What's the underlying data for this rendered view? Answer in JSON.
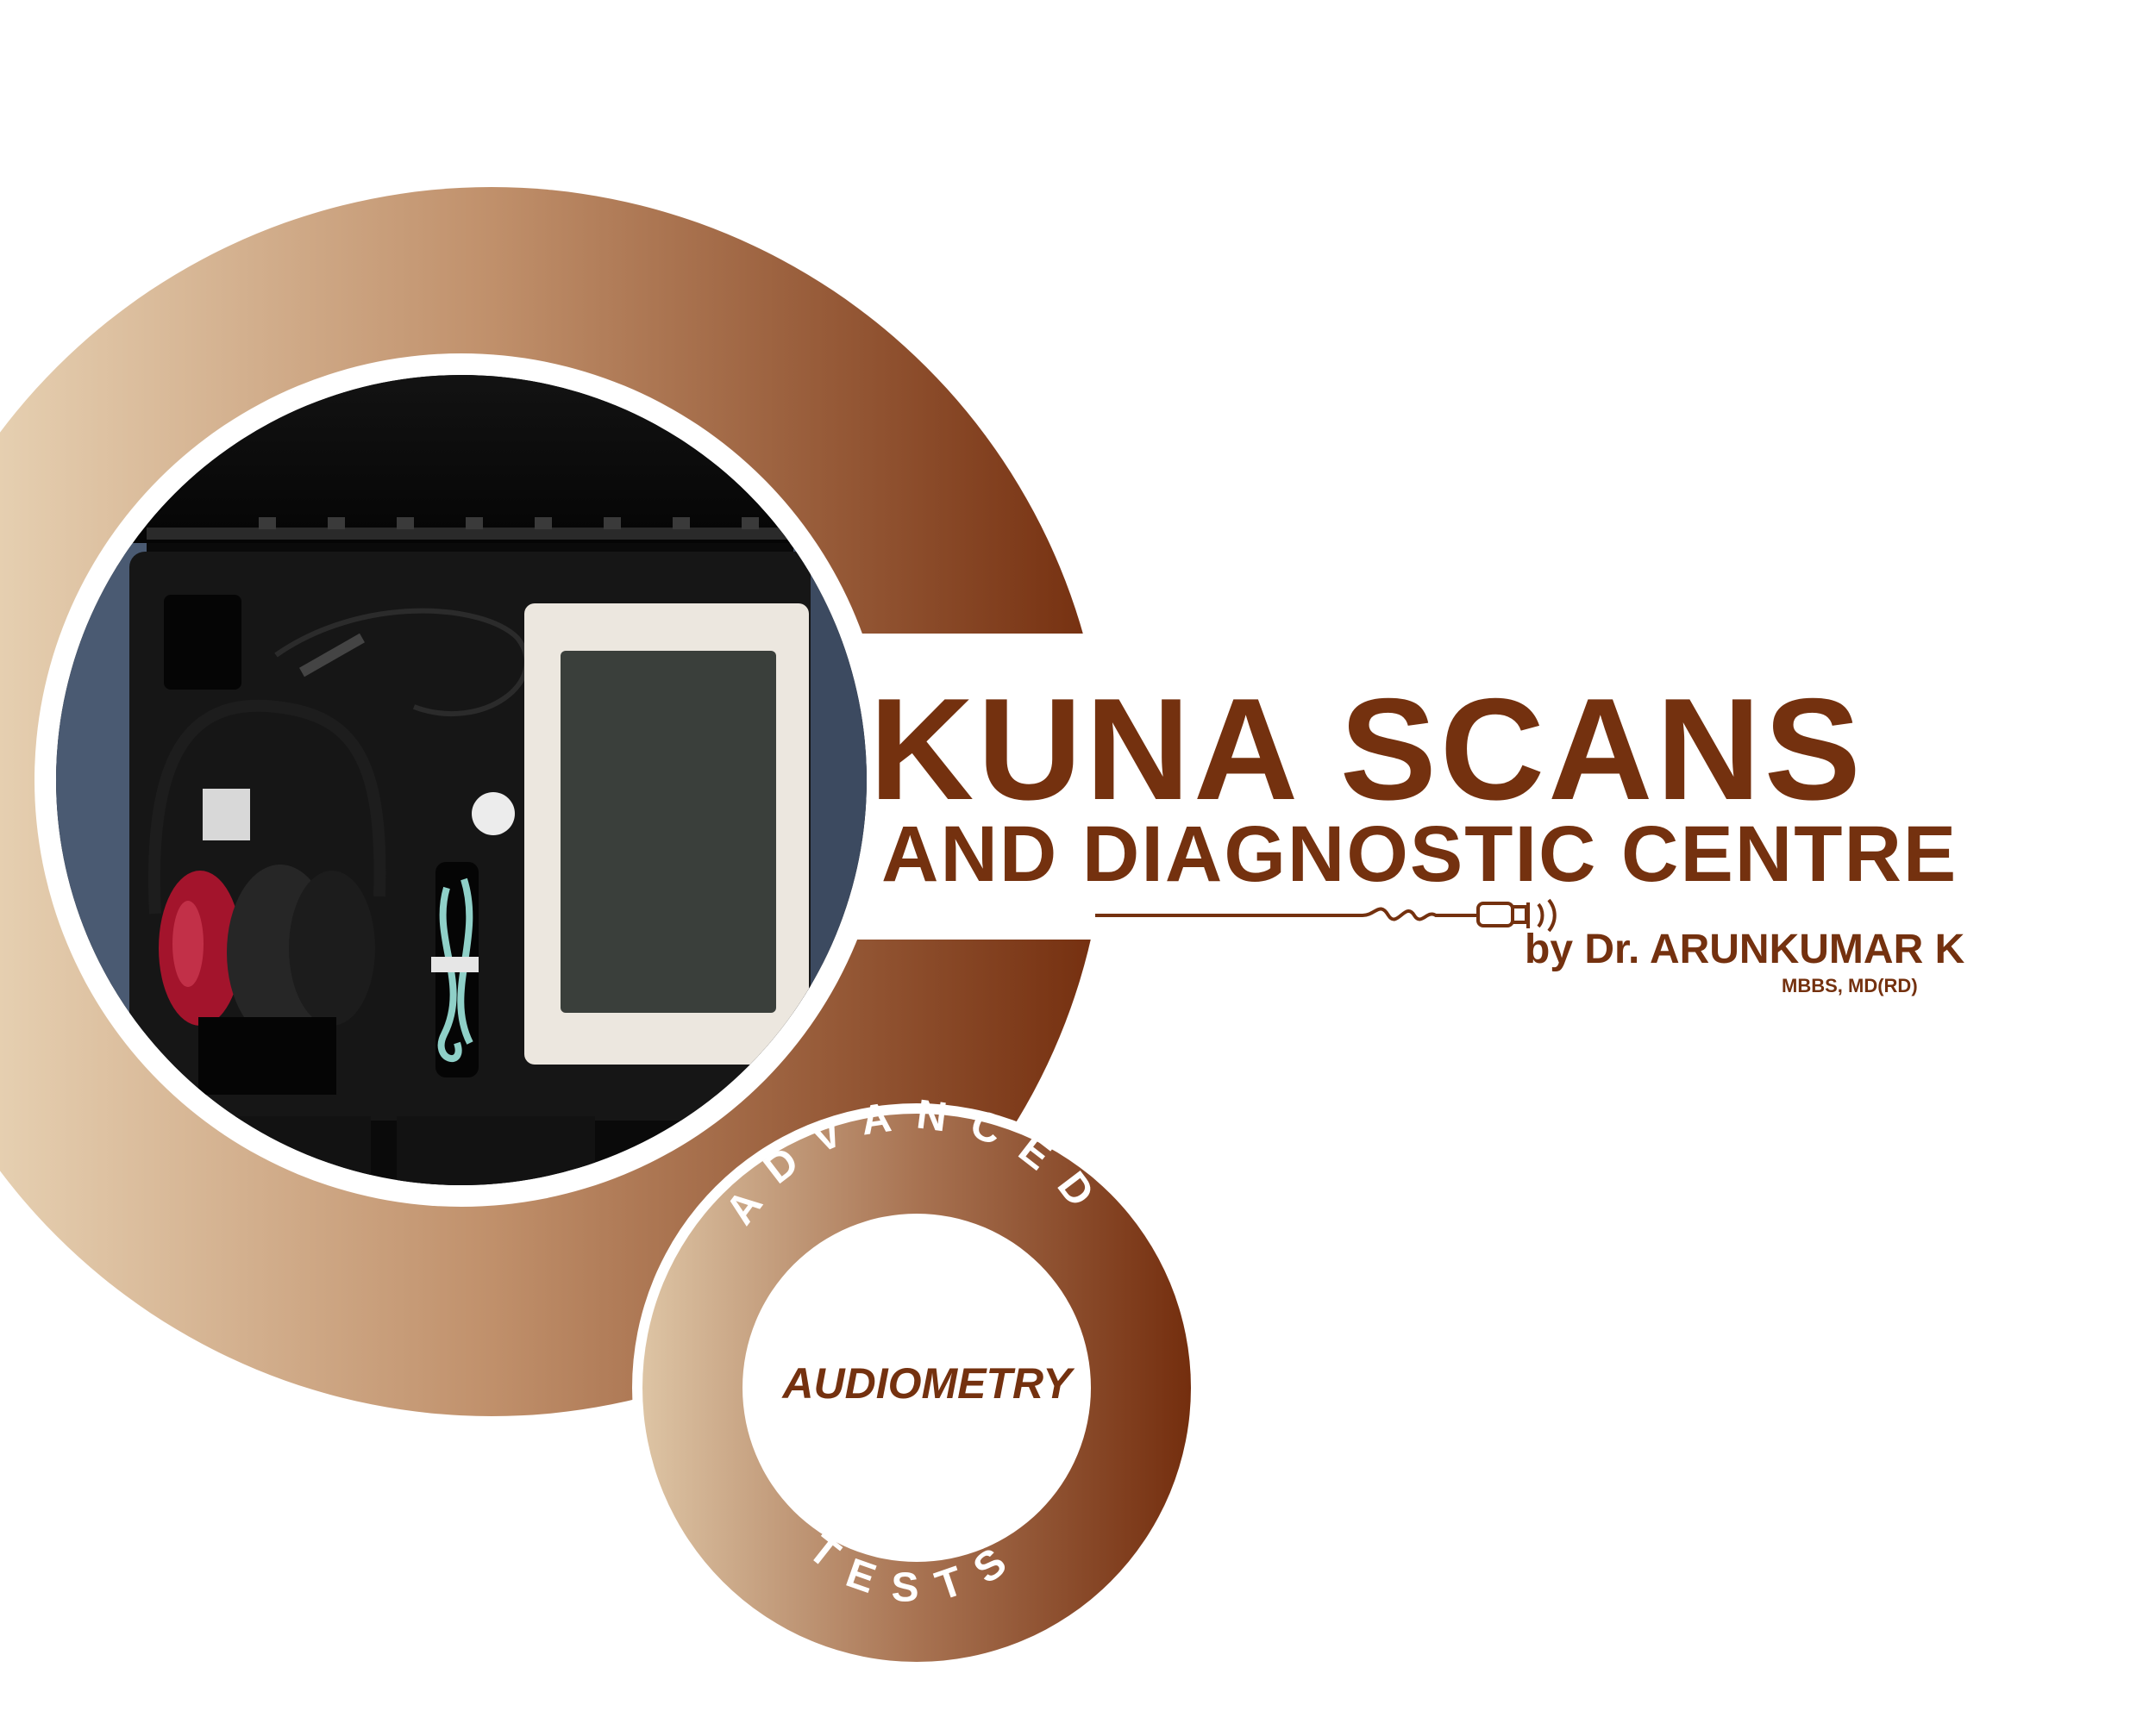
{
  "brand": {
    "title": "KUNA SCANS",
    "subtitle": "AND DIAGNOSTIC CENTRE",
    "doctor": "by Dr. ARUNKUMAR K",
    "degree": "MBBS, MD(RD)"
  },
  "badge": {
    "top_arc_text": "ADVANCED",
    "bottom_arc_text": "TESTS",
    "center_text": "AUDIOMETRY"
  },
  "colors": {
    "brand_brown": "#74310f",
    "gradient_light": "#efdfc2",
    "gradient_dark": "#742e0e",
    "background": "#ffffff"
  },
  "icons": [
    "ultrasound-probe-icon"
  ]
}
